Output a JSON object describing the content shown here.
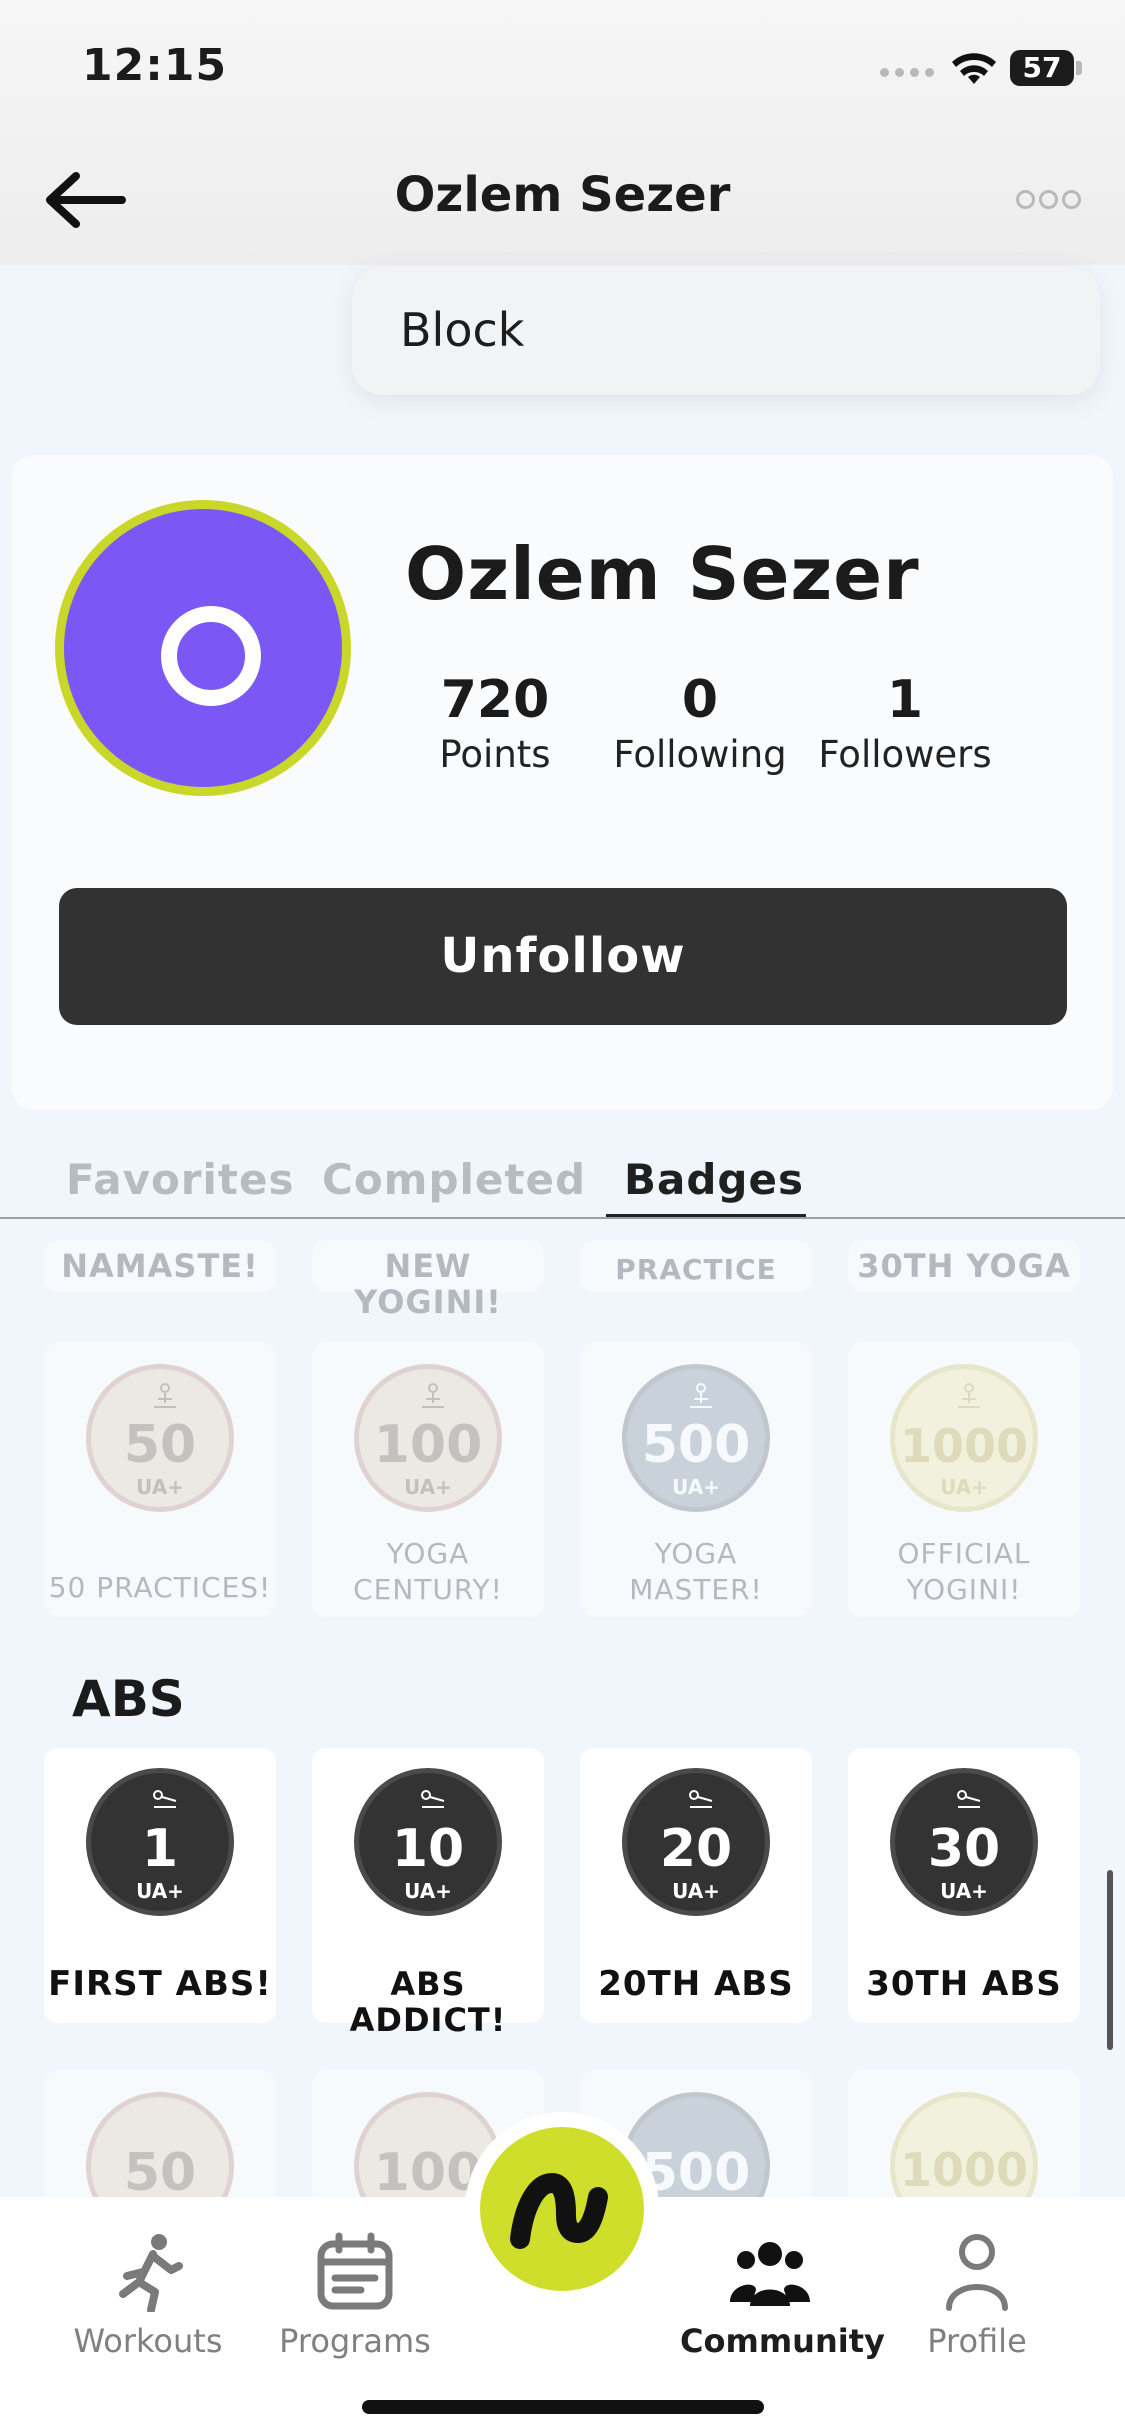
{
  "status": {
    "time": "12:15",
    "battery": "57"
  },
  "header": {
    "title": "Ozlem Sezer"
  },
  "menu": {
    "items": [
      "Block"
    ]
  },
  "profile": {
    "name": "Ozlem Sezer",
    "avatar_initial": "O",
    "stats": [
      {
        "value": "720",
        "label": "Points"
      },
      {
        "value": "0",
        "label": "Following"
      },
      {
        "value": "1",
        "label": "Followers"
      }
    ],
    "unfollow_label": "Unfollow"
  },
  "tabs": [
    {
      "label": "Favorites",
      "active": false
    },
    {
      "label": "Completed",
      "active": false
    },
    {
      "label": "Badges",
      "active": true
    }
  ],
  "yoga_partial_labels": [
    "NAMASTE!",
    "NEW YOGINI!",
    "PRACTICE",
    "30TH YOGA"
  ],
  "yoga_badges": [
    {
      "number": "50",
      "label": "50 PRACTICES!",
      "style": "beige"
    },
    {
      "number": "100",
      "label": "YOGA CENTURY!",
      "style": "beige"
    },
    {
      "number": "500",
      "label": "YOGA MASTER!",
      "style": "grey"
    },
    {
      "number": "1000",
      "label": "OFFICIAL YOGINI!",
      "style": "gold"
    }
  ],
  "abs_section": {
    "title": "ABS",
    "badges": [
      {
        "number": "1",
        "label": "FIRST ABS!"
      },
      {
        "number": "10",
        "label": "ABS ADDICT!"
      },
      {
        "number": "20",
        "label": "20TH ABS"
      },
      {
        "number": "30",
        "label": "30TH ABS"
      }
    ],
    "locked_badges": [
      {
        "number": "50",
        "style": "beige"
      },
      {
        "number": "100",
        "style": "beige"
      },
      {
        "number": "500",
        "style": "grey"
      },
      {
        "number": "1000",
        "style": "gold"
      }
    ]
  },
  "coin_logo": "UA+",
  "bottom_nav": {
    "items": [
      {
        "label": "Workouts",
        "icon": "runner-icon",
        "active": false
      },
      {
        "label": "Programs",
        "icon": "calendar-icon",
        "active": false
      },
      {
        "label": "Community",
        "icon": "people-icon",
        "active": true
      },
      {
        "label": "Profile",
        "icon": "person-icon",
        "active": false
      }
    ]
  },
  "colors": {
    "accent": "#cfdd2b",
    "avatar": "#7b58f5",
    "button": "#323232"
  }
}
